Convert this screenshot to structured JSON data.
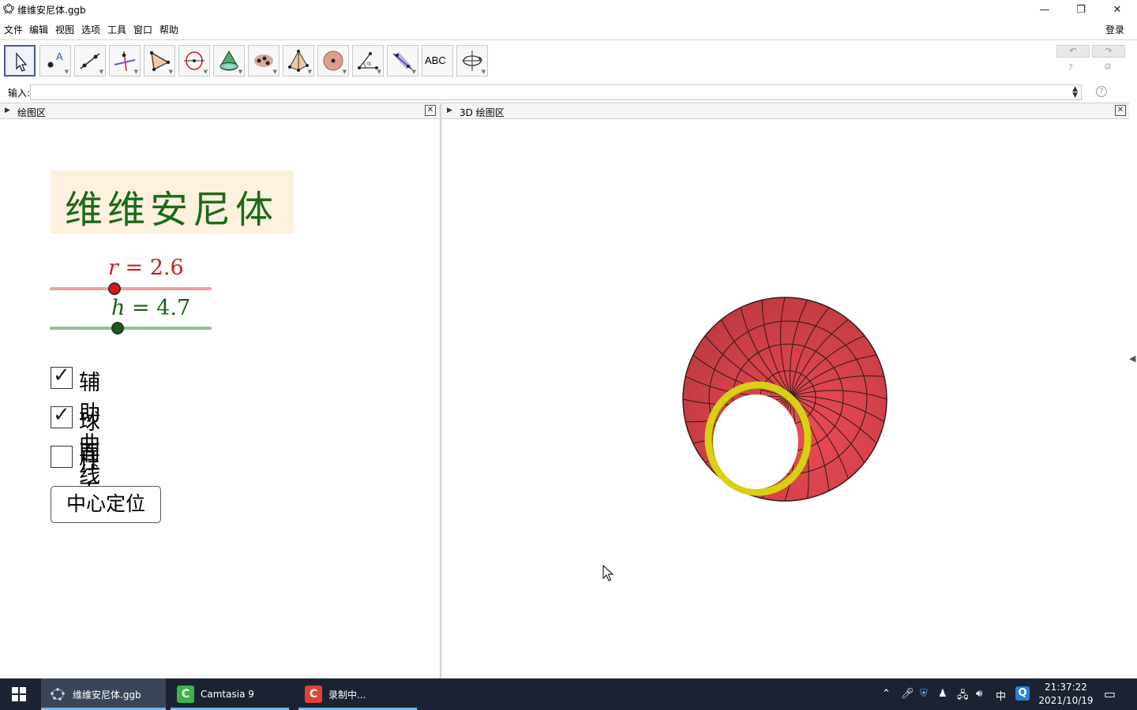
{
  "window": {
    "title": "维维安尼体.ggb",
    "min": "—",
    "restore": "❐",
    "close": "✕"
  },
  "menu": {
    "items": [
      "文件",
      "编辑",
      "视图",
      "选项",
      "工具",
      "窗口",
      "帮助"
    ],
    "login": "登录"
  },
  "toolbar": {
    "tools": [
      "move-tool",
      "point-tool",
      "line-tool",
      "perpendicular-line-tool",
      "polygon-tool",
      "circle-axis-tool",
      "cone-tool",
      "intersect-surfaces-tool",
      "pyramid-tool",
      "sphere-tool",
      "angle-tool",
      "reflect-plane-tool",
      "text-tool",
      "rotate-view-tool"
    ],
    "text_tool_label": "ABC",
    "undo": "↶",
    "redo": "↷",
    "help": "?",
    "settings": "⚙"
  },
  "input": {
    "label": "输入:",
    "value": "",
    "help": "?"
  },
  "views": {
    "graphics": {
      "title": "绘图区"
    },
    "graphics3d": {
      "title": "3D 绘图区"
    }
  },
  "panel": {
    "title": "维维安尼体",
    "sliders": [
      {
        "var": "r",
        "eq": " = 2.6",
        "value": 2.6,
        "color": "#cc1f1f",
        "track": "#f0a0a0",
        "fraction": 0.4
      },
      {
        "var": "h",
        "eq": " = 4.7",
        "value": 4.7,
        "color": "#1a5c1a",
        "track": "#8fbf8f",
        "fraction": 0.42
      }
    ],
    "checkboxes": [
      {
        "label": "辅助曲线",
        "checked": true
      },
      {
        "label": "球面",
        "checked": true
      },
      {
        "label": "柱面",
        "checked": false
      }
    ],
    "button": "中心定位"
  },
  "scene_colors": {
    "surface": "#d8404a",
    "ring": "#e8e020",
    "mesh": "#2a1a1a"
  },
  "taskbar": {
    "tasks": [
      {
        "label": "维维安尼体.ggb",
        "icon": "geogebra-icon"
      },
      {
        "label": "Camtasia 9",
        "icon": "camtasia-icon"
      },
      {
        "label": "录制中...",
        "icon": "recording-icon"
      }
    ],
    "tray_ime": "中",
    "time": "21:37:22",
    "date": "2021/10/19"
  }
}
